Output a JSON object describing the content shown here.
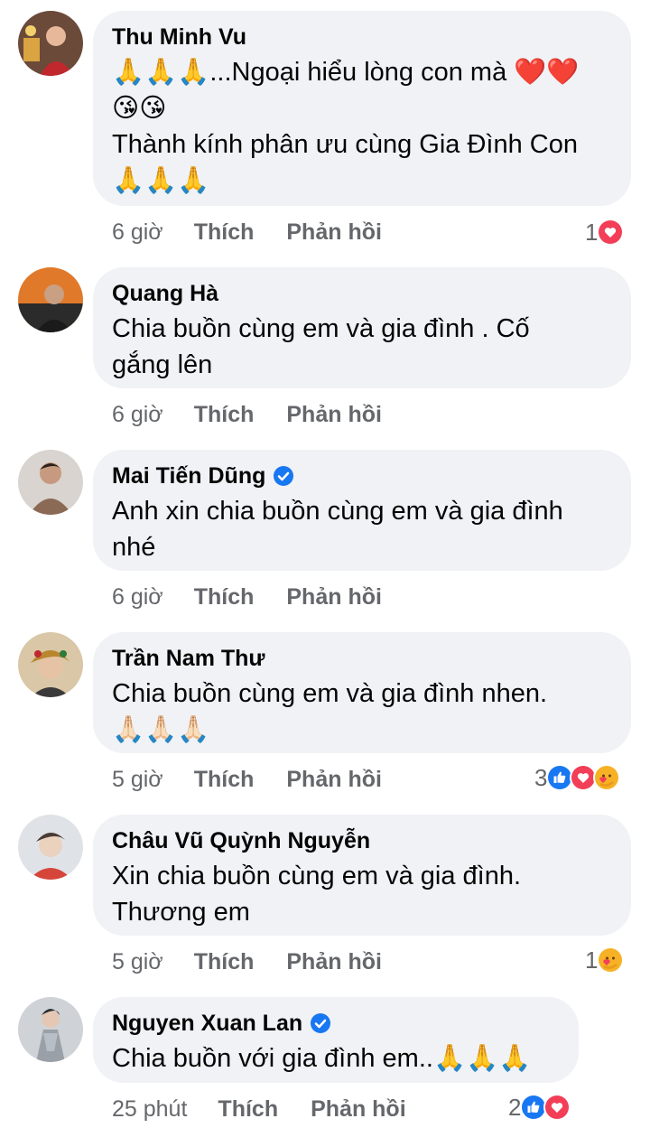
{
  "comments": [
    {
      "author": "Thu Minh Vu",
      "verified": false,
      "lines": [
        "🙏🙏🙏...Ngoại hiểu lòng con mà ❤️❤️",
        "😘😘",
        "Thành kính phân ưu cùng Gia Đình Con",
        "🙏🙏🙏"
      ],
      "time": "6 giờ",
      "like_label": "Thích",
      "reply_label": "Phản hồi",
      "reaction_count": "1",
      "reactions": [
        "heart"
      ]
    },
    {
      "author": "Quang Hà",
      "verified": false,
      "lines": [
        "Chia buồn cùng em và gia đình . Cố",
        "gắng lên"
      ],
      "time": "6 giờ",
      "like_label": "Thích",
      "reply_label": "Phản hồi",
      "reaction_count": "",
      "reactions": []
    },
    {
      "author": "Mai Tiến Dũng",
      "verified": true,
      "lines": [
        "Anh xin chia buồn cùng em và gia đình",
        "nhé"
      ],
      "time": "6 giờ",
      "like_label": "Thích",
      "reply_label": "Phản hồi",
      "reaction_count": "",
      "reactions": []
    },
    {
      "author": "Trần Nam Thư",
      "verified": false,
      "lines": [
        "Chia buồn cùng em và gia đình nhen.",
        "🙏🏻🙏🏻🙏🏻"
      ],
      "time": "5 giờ",
      "like_label": "Thích",
      "reply_label": "Phản hồi",
      "reaction_count": "3",
      "reactions": [
        "like",
        "heart",
        "care"
      ]
    },
    {
      "author": "Châu Vũ Quỳnh Nguyễn",
      "verified": false,
      "lines": [
        "Xin chia buồn cùng em và gia đình.",
        "Thương em"
      ],
      "time": "5 giờ",
      "like_label": "Thích",
      "reply_label": "Phản hồi",
      "reaction_count": "1",
      "reactions": [
        "care"
      ]
    },
    {
      "author": "Nguyen Xuan Lan",
      "verified": true,
      "lines": [
        "Chia buồn với gia đình em..🙏🙏🙏"
      ],
      "time": "25 phút",
      "like_label": "Thích",
      "reply_label": "Phản hồi",
      "reaction_count": "2",
      "reactions": [
        "like",
        "heart"
      ]
    }
  ],
  "colors": {
    "bubble": "#f0f2f5",
    "meta_text": "#65676b",
    "like_blue": "#1877f2",
    "heart_red": "#f33e58",
    "care_yellow": "#f7b125"
  }
}
